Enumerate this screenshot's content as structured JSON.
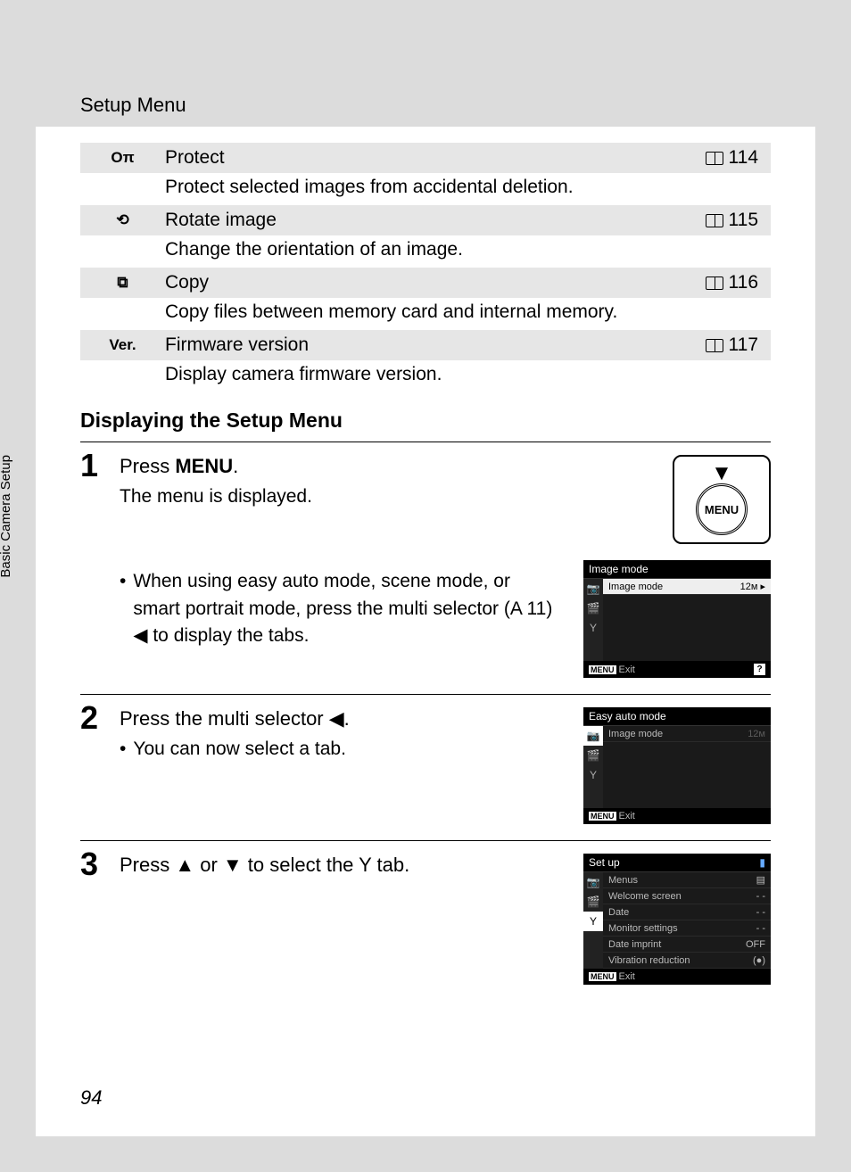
{
  "header": {
    "section": "Setup Menu"
  },
  "sideTab": "Basic Camera Setup",
  "pageNumber": "94",
  "menuItems": [
    {
      "icon": "Oπ",
      "title": "Protect",
      "page": "114",
      "desc": "Protect selected images from accidental deletion."
    },
    {
      "icon": "⟲",
      "title": "Rotate image",
      "page": "115",
      "desc": "Change the orientation of an image."
    },
    {
      "icon": "⧉",
      "title": "Copy",
      "page": "116",
      "desc": "Copy files between memory card and internal memory."
    },
    {
      "icon": "Ver.",
      "title": "Firmware version",
      "page": "117",
      "desc": "Display camera firmware version."
    }
  ],
  "subheading": "Displaying the Setup Menu",
  "steps": {
    "s1": {
      "num": "1",
      "titlePrefix": "Press ",
      "titleWord": "MENU",
      "titleSuffix": ".",
      "text": "The menu is displayed.",
      "bullet": "When using easy auto mode, scene mode, or smart portrait mode, press the multi selector (A 11) ◀ to display the tabs.",
      "buttonLabel": "MENU",
      "screen": {
        "header": "Image mode",
        "item": "Image mode",
        "exit": "Exit"
      }
    },
    "s2": {
      "num": "2",
      "title": "Press the multi selector ◀.",
      "bullet": "You can now select a tab.",
      "screen": {
        "header": "Easy auto mode",
        "item": "Image mode",
        "exit": "Exit"
      }
    },
    "s3": {
      "num": "3",
      "title": "Press ▲ or ▼ to select the Y tab.",
      "screen": {
        "header": "Set up",
        "items": [
          {
            "label": "Menus",
            "val": "▤"
          },
          {
            "label": "Welcome screen",
            "val": "- -"
          },
          {
            "label": "Date",
            "val": "- -"
          },
          {
            "label": "Monitor settings",
            "val": "- -"
          },
          {
            "label": "Date imprint",
            "val": "OFF"
          },
          {
            "label": "Vibration reduction",
            "val": "(●)"
          }
        ],
        "exit": "Exit"
      }
    }
  }
}
